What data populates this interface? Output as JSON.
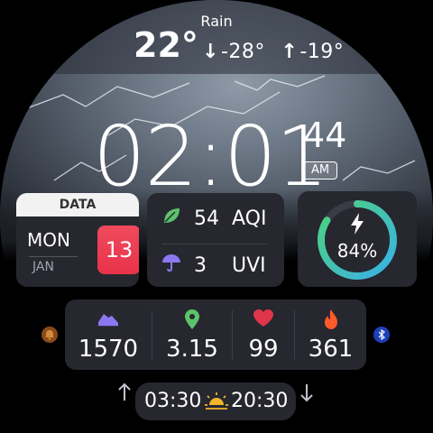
{
  "weather": {
    "condition": "Rain",
    "current_temp": "22°",
    "low": "-28°",
    "high": "-19°"
  },
  "clock": {
    "time": "02:01",
    "seconds": "44",
    "ampm": "AM"
  },
  "date": {
    "header": "DATA",
    "weekday": "MON",
    "month": "JAN",
    "day": "13"
  },
  "air": {
    "aqi_value": "54",
    "aqi_label": "AQI",
    "uvi_value": "3",
    "uvi_label": "UVI"
  },
  "battery": {
    "percent_text": "84%",
    "level": 0.84
  },
  "stats": {
    "steps": "1570",
    "distance": "3.15",
    "heart_rate": "99",
    "calories": "361"
  },
  "sun": {
    "sunrise": "03:30",
    "sunset": "20:30"
  },
  "icons": {
    "aqi": "leaf-icon",
    "uvi": "umbrella-icon",
    "battery": "bolt-icon",
    "steps": "shoe-icon",
    "distance": "location-pin-icon",
    "heart": "heart-icon",
    "calories": "flame-icon",
    "alarm": "bell-icon",
    "bluetooth": "bluetooth-icon",
    "sun": "sunrise-icon"
  },
  "colors": {
    "heart": "#e0354a",
    "flame": "#ff5a2a",
    "leaf": "#5cc36a",
    "umbrella": "#8b78f0",
    "steps": "#8b78f0",
    "pin": "#5cc36a",
    "day_box": "#e8334a",
    "sun": "#f5b52a"
  }
}
